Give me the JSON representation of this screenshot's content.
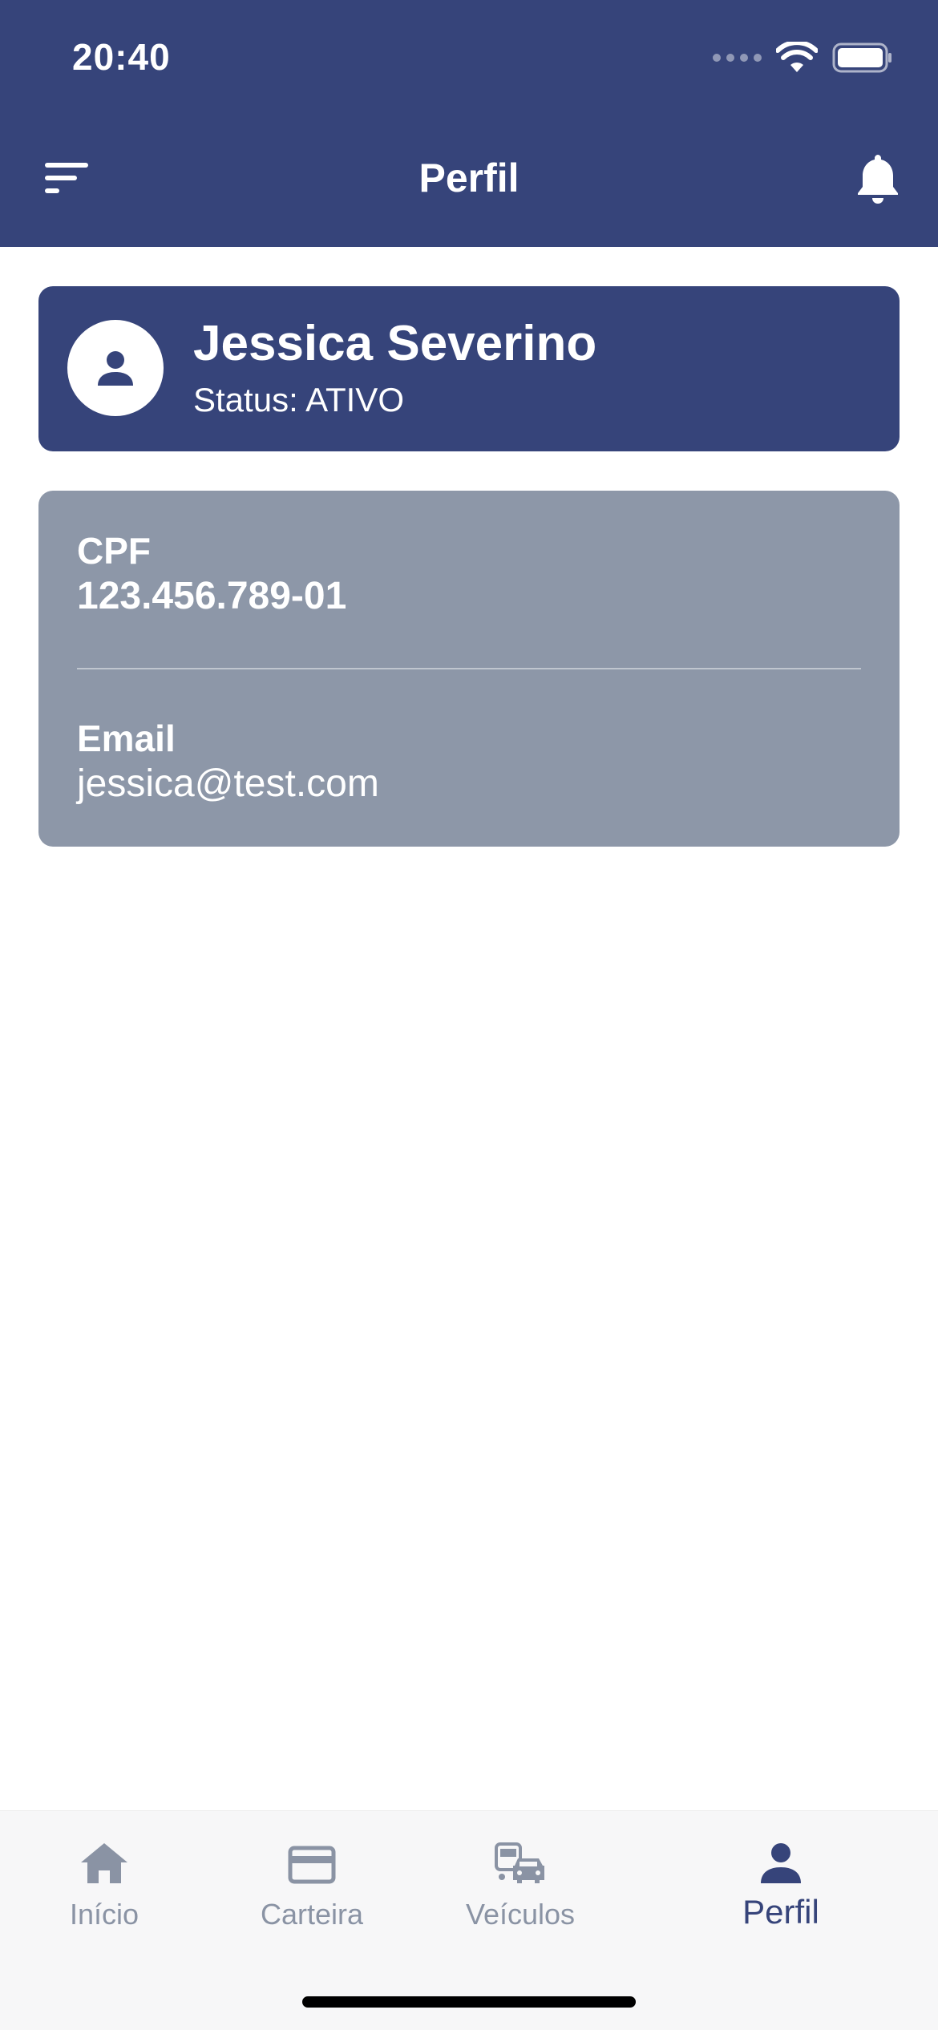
{
  "status_bar": {
    "time": "20:40"
  },
  "header": {
    "title": "Perfil",
    "menu_icon": "sort-menu-icon",
    "notification_icon": "bell-icon"
  },
  "profile": {
    "name": "Jessica Severino",
    "status": "Status: ATIVO",
    "avatar_icon": "person-icon"
  },
  "info": {
    "cpf_label": "CPF",
    "cpf_value": "123.456.789-01",
    "email_label": "Email",
    "email_value": "jessica@test.com"
  },
  "tabs": [
    {
      "label": "Início",
      "icon": "home-icon",
      "active": false
    },
    {
      "label": "Carteira",
      "icon": "credit-card-icon",
      "active": false
    },
    {
      "label": "Veículos",
      "icon": "vehicles-icon",
      "active": false
    },
    {
      "label": "Perfil",
      "icon": "person-icon",
      "active": true
    }
  ],
  "colors": {
    "primary": "#36447a",
    "card_gray": "#8d97a8",
    "tab_inactive": "#8a93a4",
    "tab_bar_bg": "#f7f7f8"
  }
}
